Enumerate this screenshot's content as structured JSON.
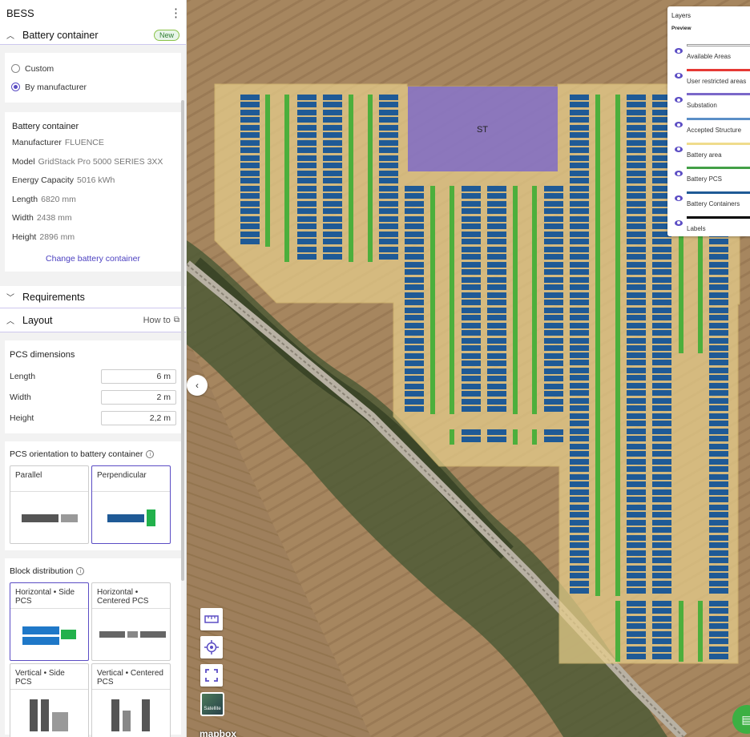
{
  "app": {
    "title": "BESS"
  },
  "battery_section": {
    "title": "Battery container",
    "badge": "New"
  },
  "source_options": [
    {
      "label": "Custom",
      "selected": false
    },
    {
      "label": "By manufacturer",
      "selected": true
    }
  ],
  "battery_card": {
    "title": "Battery container",
    "fields": [
      {
        "label": "Manufacturer",
        "value": "FLUENCE"
      },
      {
        "label": "Model",
        "value": "GridStack Pro 5000 SERIES 3XX"
      },
      {
        "label": "Energy Capacity",
        "value": "5016 kWh"
      },
      {
        "label": "Length",
        "value": "6820 mm"
      },
      {
        "label": "Width",
        "value": "2438 mm"
      },
      {
        "label": "Height",
        "value": "2896 mm"
      }
    ],
    "change_link": "Change battery container"
  },
  "requirements": {
    "title": "Requirements"
  },
  "layout": {
    "title": "Layout",
    "howto": "How to"
  },
  "pcs_dimensions": {
    "title": "PCS dimensions",
    "fields": [
      {
        "label": "Length",
        "value": "6 m"
      },
      {
        "label": "Width",
        "value": "2 m"
      },
      {
        "label": "Height",
        "value": "2,2 m"
      }
    ]
  },
  "pcs_orientation": {
    "title": "PCS orientation to battery container",
    "options": [
      {
        "label": "Parallel",
        "selected": false
      },
      {
        "label": "Perpendicular",
        "selected": true
      }
    ]
  },
  "block_distribution": {
    "title": "Block distribution",
    "options": [
      {
        "label": "Horizontal • Side PCS",
        "selected": true
      },
      {
        "label": "Horizontal • Centered PCS",
        "selected": false
      },
      {
        "label": "Vertical • Side PCS",
        "selected": false
      },
      {
        "label": "Vertical • Centered PCS",
        "selected": false
      }
    ]
  },
  "map": {
    "substation_label": "ST",
    "satellite_label": "Satellite",
    "attribution": "mapbox",
    "colors": {
      "available_area": "#e8cf8c",
      "substation": "#7b68c9",
      "battery_container": "#1f5a96",
      "battery_pcs": "#4caf3c"
    }
  },
  "layers_panel": {
    "title": "Layers",
    "preview_label": "Preview",
    "layers": [
      {
        "name": "Available Areas",
        "color": "#ffffff"
      },
      {
        "name": "User restricted areas",
        "color": "#e53935"
      },
      {
        "name": "Substation",
        "color": "#7b68c9"
      },
      {
        "name": "Accepted Structure",
        "color": "#5b8fc7"
      },
      {
        "name": "Battery area",
        "color": "#f0dc8c"
      },
      {
        "name": "Battery PCS",
        "color": "#43a047"
      },
      {
        "name": "Battery Containers",
        "color": "#1f5a96"
      },
      {
        "name": "Labels",
        "color": "#000000"
      }
    ]
  }
}
